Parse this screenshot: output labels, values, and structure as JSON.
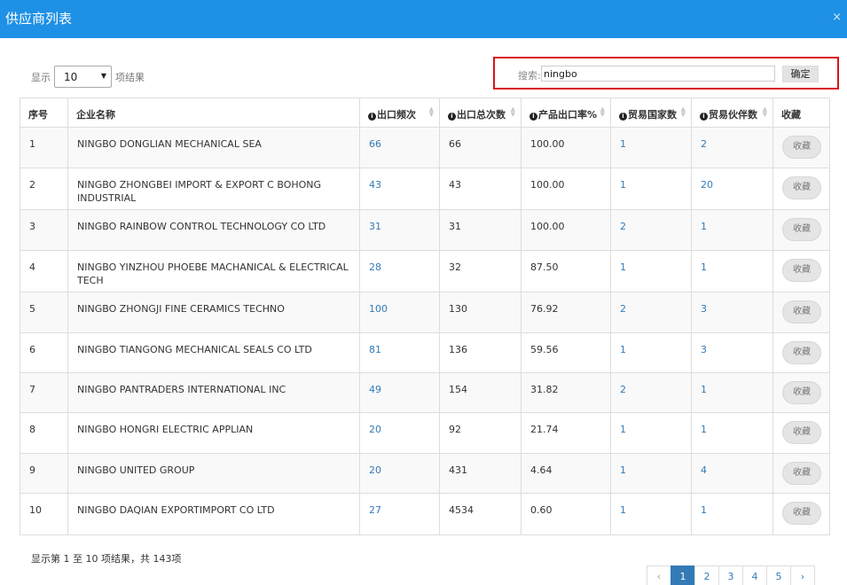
{
  "dialog": {
    "title": "供应商列表",
    "close": "×"
  },
  "length": {
    "prefix": "显示",
    "value": "10",
    "suffix": "项结果"
  },
  "search": {
    "label": "搜索:",
    "value": "ningbo",
    "button": "确定"
  },
  "table": {
    "headers": {
      "index": "序号",
      "company": "企业名称",
      "export_freq": "出口频次",
      "export_total": "出口总次数",
      "export_rate": "产品出口率%",
      "countries": "贸易国家数",
      "partners": "贸易伙伴数",
      "favorite": "收藏"
    },
    "rows": [
      {
        "index": "1",
        "company": "NINGBO DONGLIAN MECHANICAL SEA",
        "export_freq": "66",
        "export_total": "66",
        "export_rate": "100.00",
        "countries": "1",
        "partners": "2",
        "fav": "收藏"
      },
      {
        "index": "2",
        "company": "NINGBO ZHONGBEI IMPORT & EXPORT C BOHONG INDUSTRIAL",
        "export_freq": "43",
        "export_total": "43",
        "export_rate": "100.00",
        "countries": "1",
        "partners": "20",
        "fav": "收藏"
      },
      {
        "index": "3",
        "company": "NINGBO RAINBOW CONTROL TECHNOLOGY CO LTD",
        "export_freq": "31",
        "export_total": "31",
        "export_rate": "100.00",
        "countries": "2",
        "partners": "1",
        "fav": "收藏"
      },
      {
        "index": "4",
        "company": "NINGBO YINZHOU PHOEBE MACHANICAL & ELECTRICAL TECH",
        "export_freq": "28",
        "export_total": "32",
        "export_rate": "87.50",
        "countries": "1",
        "partners": "1",
        "fav": "收藏"
      },
      {
        "index": "5",
        "company": "NINGBO ZHONGJI FINE CERAMICS TECHNO",
        "export_freq": "100",
        "export_total": "130",
        "export_rate": "76.92",
        "countries": "2",
        "partners": "3",
        "fav": "收藏"
      },
      {
        "index": "6",
        "company": "NINGBO TIANGONG MECHANICAL SEALS CO LTD",
        "export_freq": "81",
        "export_total": "136",
        "export_rate": "59.56",
        "countries": "1",
        "partners": "3",
        "fav": "收藏"
      },
      {
        "index": "7",
        "company": "NINGBO PANTRADERS INTERNATIONAL INC",
        "export_freq": "49",
        "export_total": "154",
        "export_rate": "31.82",
        "countries": "2",
        "partners": "1",
        "fav": "收藏"
      },
      {
        "index": "8",
        "company": "NINGBO HONGRI ELECTRIC APPLIAN",
        "export_freq": "20",
        "export_total": "92",
        "export_rate": "21.74",
        "countries": "1",
        "partners": "1",
        "fav": "收藏"
      },
      {
        "index": "9",
        "company": "NINGBO UNITED GROUP",
        "export_freq": "20",
        "export_total": "431",
        "export_rate": "4.64",
        "countries": "1",
        "partners": "4",
        "fav": "收藏"
      },
      {
        "index": "10",
        "company": "NINGBO DAQIAN EXPORTIMPORT CO LTD",
        "export_freq": "27",
        "export_total": "4534",
        "export_rate": "0.60",
        "countries": "1",
        "partners": "1",
        "fav": "收藏"
      }
    ]
  },
  "info": "显示第 1 至 10 项结果，共 143项",
  "pagination": {
    "prev": "‹",
    "pages": [
      "1",
      "2",
      "3",
      "4",
      "5"
    ],
    "next": "›",
    "current": "1"
  },
  "colors": {
    "titlebar": "#1e90e6",
    "link": "#337ab7",
    "highlight_border": "#d9141e"
  },
  "icons": {
    "info": "info-circle-icon",
    "sort": "sort-icon",
    "close": "close-icon",
    "dropdown": "caret-down-icon"
  }
}
